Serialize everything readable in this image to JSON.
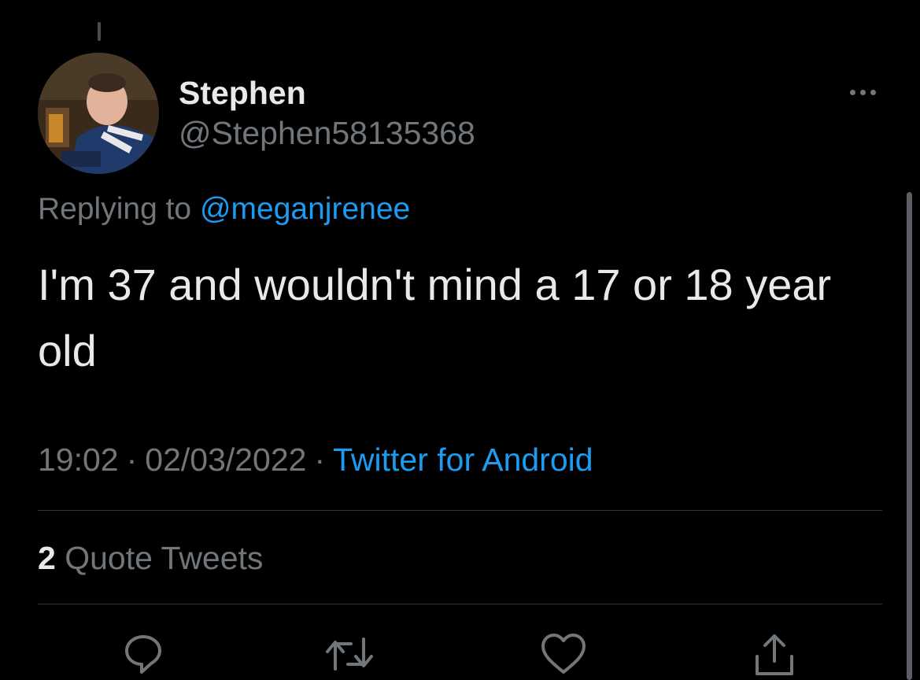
{
  "tweet": {
    "author": {
      "display_name": "Stephen",
      "handle": "@Stephen58135368"
    },
    "replying_prefix": "Replying to ",
    "replying_to": "@meganjrenee",
    "text": "I'm 37 and wouldn't mind a 17 or 18 year old",
    "time": "19:02",
    "separator": "·",
    "date": "02/03/2022",
    "source": "Twitter for Android"
  },
  "stats": {
    "quote_count": "2",
    "quote_label": " Quote Tweets"
  },
  "actions": [
    {
      "name": "reply",
      "icon": "comment-icon"
    },
    {
      "name": "retweet",
      "icon": "retweet-icon"
    },
    {
      "name": "like",
      "icon": "heart-icon"
    },
    {
      "name": "share",
      "icon": "share-icon"
    }
  ],
  "colors": {
    "background": "#000000",
    "text_primary": "#e7e9ea",
    "text_secondary": "#71767b",
    "accent": "#1d9bf0",
    "divider": "#2f3336"
  }
}
